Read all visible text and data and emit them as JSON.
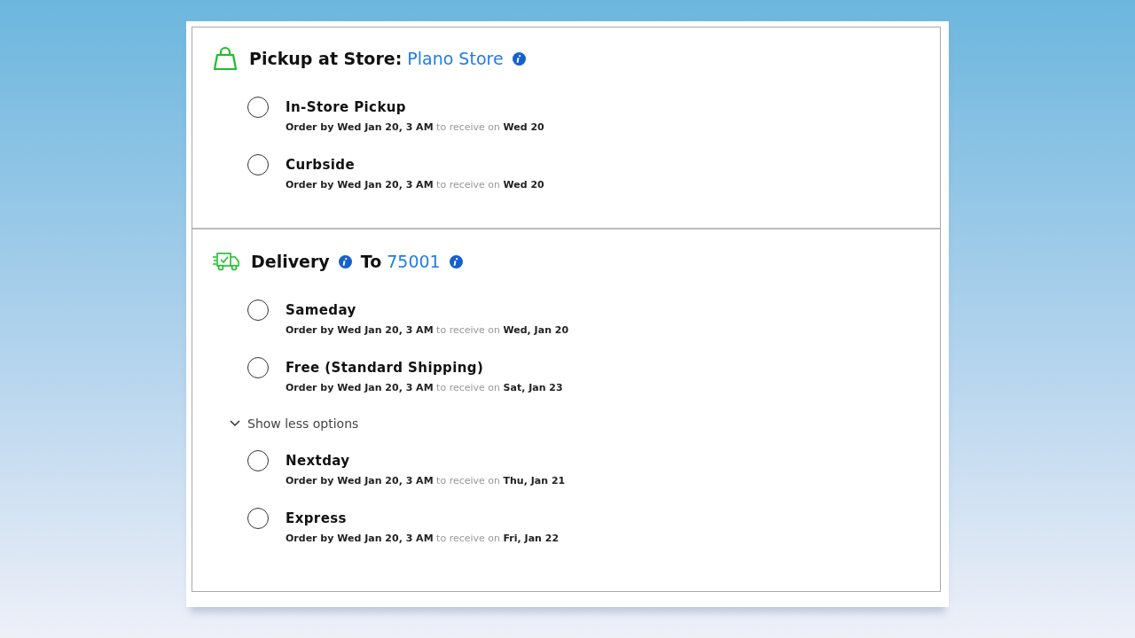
{
  "sections": [
    {
      "kind": "pickup",
      "title": "Pickup at Store:",
      "link": "Plano Store",
      "link_info": true,
      "options": [
        {
          "label": "In-Store Pickup",
          "detail": "**Order by Wed Jan 20, 3 AM** to receive on **Wed 20**",
          "selected": false
        },
        {
          "label": "Curbside",
          "detail": "**Order by Wed Jan 20, 3 AM** to receive on **Wed 20**",
          "selected": false
        }
      ]
    },
    {
      "kind": "delivery",
      "title": "Delivery",
      "title_info": true,
      "prefix": "To",
      "link": "75001",
      "link_info": true,
      "options": [
        {
          "label": "Sameday",
          "detail": "**Order by Wed Jan 20, 3 AM** to receive on **Wed, Jan 20**",
          "selected": false
        },
        {
          "label": "Free (Standard Shipping)",
          "detail": "**Order by Wed Jan 20, 3 AM** to receive on **Sat, Jan 23**",
          "selected": false
        }
      ],
      "toggle": {
        "label": "Show less options",
        "expanded": true
      },
      "more_options": [
        {
          "label": "Nextday",
          "detail": "**Order by Wed Jan 20, 3 AM** to receive on **Thu, Jan 21**",
          "selected": false
        },
        {
          "label": "Express",
          "detail": "**Order by Wed Jan 20, 3 AM** to receive on **Fri, Jan 22**",
          "selected": false
        }
      ]
    }
  ]
}
